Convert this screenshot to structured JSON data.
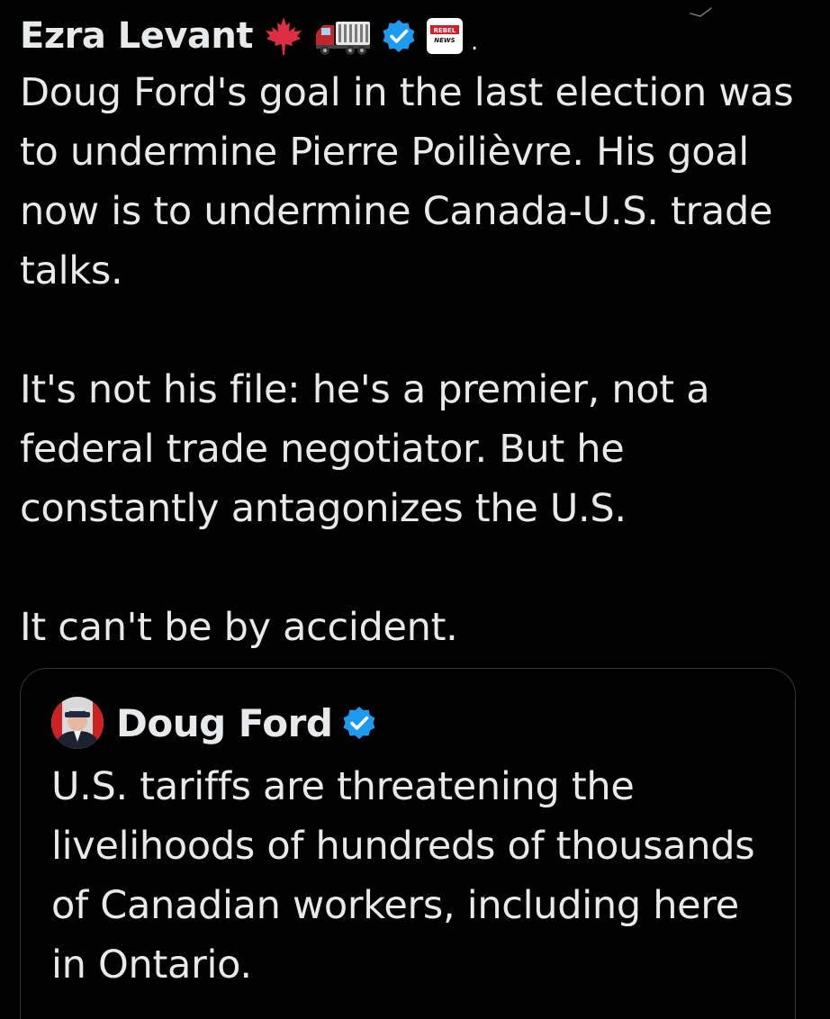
{
  "tweet": {
    "author_name": "Ezra Levant",
    "verified_color": "#1d9bf0",
    "affiliation_badge_text": "REBEL NEWS",
    "separator": ".",
    "paragraphs": [
      "Doug Ford's goal in the last election was to undermine Pierre Poilièvre. His goal now is to undermine Canada-U.S. trade talks.",
      "It's not his file: he's a premier, not a federal trade negotiator. But he constantly antagonizes the U.S.",
      "It can't be by accident."
    ],
    "emoji_icons": [
      "maple-leaf-icon",
      "truck-icon"
    ]
  },
  "quoted_tweet": {
    "author_name": "Doug Ford",
    "verified_color": "#1d9bf0",
    "text": "U.S. tariffs are threatening the livelihoods of hundreds of thousands of Canadian workers, including here in Ontario."
  },
  "colors": {
    "background": "#000000",
    "text": "#e7e9ea",
    "border": "#2f3336",
    "maple_red": "#dd2e44",
    "truck_red": "#c1272d"
  }
}
